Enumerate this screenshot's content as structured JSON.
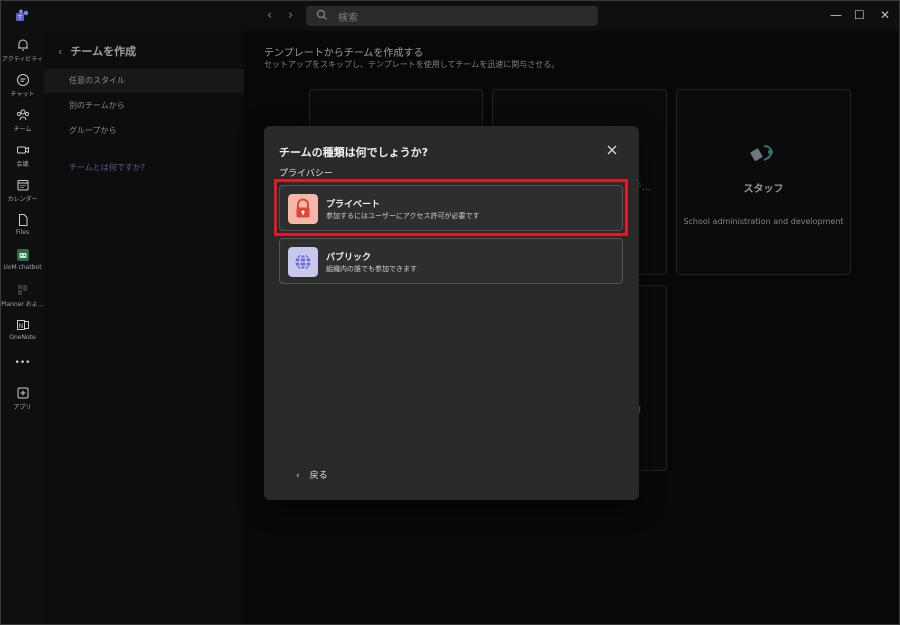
{
  "search": {
    "placeholder": "検索"
  },
  "window_controls": {
    "minimize": "—",
    "maximize": "☐",
    "close": "✕"
  },
  "rail": {
    "items": [
      {
        "label": "アクティビティ",
        "icon": "bell-icon"
      },
      {
        "label": "チャット",
        "icon": "chat-icon"
      },
      {
        "label": "チーム",
        "icon": "teams-icon"
      },
      {
        "label": "会議",
        "icon": "video-icon"
      },
      {
        "label": "カレンダー",
        "icon": "calendar-icon"
      },
      {
        "label": "Files",
        "icon": "file-icon"
      },
      {
        "label": "UoM chatbot",
        "icon": "bot-icon"
      },
      {
        "label": "Planner およ…",
        "icon": "planner-icon"
      },
      {
        "label": "OneNote",
        "icon": "onenote-icon"
      },
      {
        "label": "•••",
        "icon": "more-icon"
      },
      {
        "label": "アプリ",
        "icon": "add-app-icon"
      }
    ]
  },
  "panel": {
    "title": "チームを作成",
    "items": [
      {
        "label": "任意のスタイル"
      },
      {
        "label": "別のチームから"
      },
      {
        "label": "グループから"
      }
    ],
    "link": "チームとは何ですか?"
  },
  "main": {
    "title": "テンプレートからチームを作成する",
    "subtitle": "セットアップをスキップし、テンプレートを使用してチームを迅速に関与させる。",
    "cards": {
      "staff_title": "スタッフ",
      "staff_desc": "School administration and development",
      "partial_1": "テ...",
      "partial_2": "ol"
    }
  },
  "dialog": {
    "title": "チームの種類は何でしょうか?",
    "section_label": "プライバシー",
    "options": [
      {
        "title": "プライベート",
        "desc": "参加するにはユーザーにアクセス許可が必要です",
        "icon": "lock-icon"
      },
      {
        "title": "パブリック",
        "desc": "組織内の誰でも参加できます",
        "icon": "globe-icon"
      }
    ],
    "back_label": "戻る"
  },
  "colors": {
    "highlight": "#e0192a",
    "link": "#8c8fe0",
    "private_icon_bg": "#f6b7a8",
    "public_icon_bg": "#c8c8ee"
  }
}
